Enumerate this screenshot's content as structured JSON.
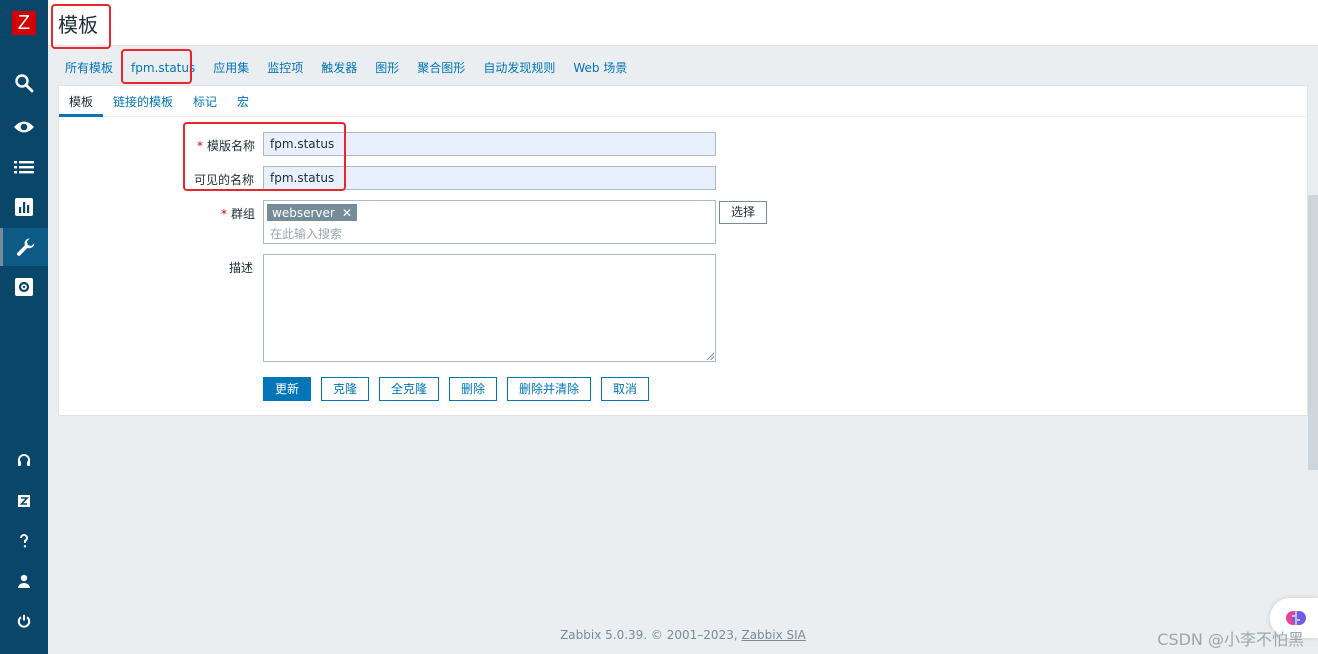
{
  "app": {
    "logo_letter": "Z"
  },
  "header": {
    "title": "模板"
  },
  "top_tabs": [
    {
      "label": "所有模板"
    },
    {
      "label": "fpm.status"
    },
    {
      "label": "应用集"
    },
    {
      "label": "监控项"
    },
    {
      "label": "触发器"
    },
    {
      "label": "图形"
    },
    {
      "label": "聚合图形"
    },
    {
      "label": "自动发现规则"
    },
    {
      "label": "Web 场景"
    }
  ],
  "sub_tabs": [
    {
      "label": "模板"
    },
    {
      "label": "链接的模板"
    },
    {
      "label": "标记"
    },
    {
      "label": "宏"
    }
  ],
  "form": {
    "template_name_label": "模版名称",
    "template_name_value": "fpm.status",
    "visible_name_label": "可见的名称",
    "visible_name_value": "fpm.status",
    "groups_label": "群组",
    "group_tag": "webserver",
    "groups_placeholder": "在此输入搜索",
    "select_label": "选择",
    "description_label": "描述",
    "required_mark": "*"
  },
  "buttons": {
    "update": "更新",
    "clone": "克隆",
    "full_clone": "全克隆",
    "delete": "删除",
    "delete_clear": "删除并清除",
    "cancel": "取消"
  },
  "footer": {
    "text": "Zabbix 5.0.39. © 2001–2023, ",
    "link": "Zabbix SIA"
  },
  "watermark": "CSDN @小李不怕黑",
  "colors": {
    "sidebar": "#0a466a",
    "accent": "#0275b8",
    "required": "#d40000",
    "annotation": "#e8262c"
  }
}
